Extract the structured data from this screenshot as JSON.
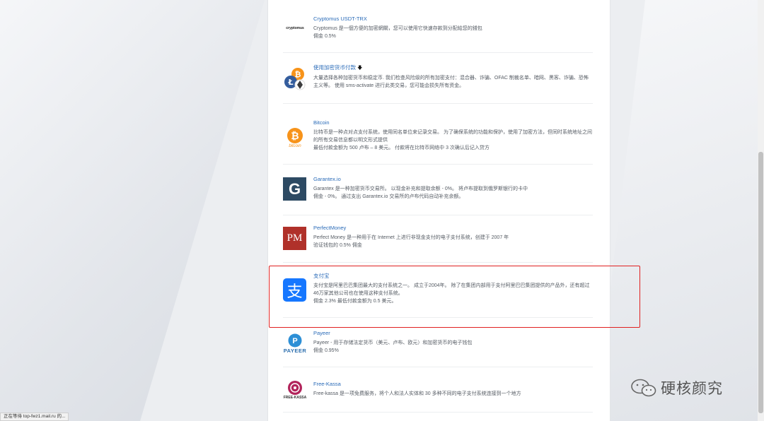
{
  "payments": [
    {
      "title": "Cryptomus USDT-TRX",
      "logo_text": "cryptomus",
      "desc": "Cryptomus 是一個方便的加密網關，您可以使用它快速存款到分配給您的錢包",
      "meta": "佣金 0.5%"
    },
    {
      "title": "使用加密货币付款",
      "title_icon": "arrow-down-icon",
      "desc": "大量选择各种加密货币和稳定币. 我们检查风险级的所有加密支付：混合器、诈骗、OFAC 制裁名单、暗网、黑客、诈骗、恐怖主义等。 使用 sms-activate 进行此类交易，您可能会损失所有资金。",
      "meta": ""
    },
    {
      "title": "Bitcoin",
      "logo_text": "bitcoin",
      "desc": "比特币是一种点对点支付系统，使用同名单位来记录交易。 为了确保系统的功能和保护，使用了加密方法，但同时系统地址之间的所有交易信息都以明文形式提供",
      "meta": "最低付款金额为 500 卢布 – 8 美元。 付款将在比特币网络中 3 次确认后记入贷方"
    },
    {
      "title": "Garantex.io",
      "logo_text": "G",
      "desc": "Garantex 是一种加密货币交易所。 以现金补充和提取余额 - 0%。 将卢布提取到俄罗斯银行的卡中",
      "meta": "佣金 - 0%。 通过支出 Garantex.io 交易所的卢布代码自动补充余额。"
    },
    {
      "title": "PerfectMoney",
      "logo_text": "PM",
      "desc": "Perfect Money 是一种用于在 Internet 上进行非现金支付的电子支付系统，创建于 2007 年",
      "meta": "验证钱包的 0.5% 佣金"
    },
    {
      "title": "支付宝",
      "logo_text": "支",
      "desc": "支付宝是阿里巴巴集团最大的支付系统之一。 成立于2004年。 除了在集团内部用于支付阿里巴巴集团提供的产品外，还有超过46万家其他公司也在使用这种支付系统。",
      "meta": "佣金 2.3% 最低付款金额为 0.5 美元。"
    },
    {
      "title": "Payeer",
      "logo_text": "PAYEER",
      "logo_letter": "P",
      "desc": "Payeer - 用于存储法定货币（美元、卢布、欧元）和加密货币的电子钱包",
      "meta": "佣金 0.95%"
    },
    {
      "title": "Free-Kassa",
      "logo_text": "FREE-KASSA",
      "desc": "Free-kassa 是一项免费服务，将个人和法人实体和 30 多种不同的电子支付系统连接到一个地方",
      "meta": ""
    }
  ],
  "status_text": "正在等待 top-fwz1.mail.ru 的...",
  "watermark_text": "硬核颜究",
  "colors": {
    "link": "#2a6bb8",
    "highlight": "#e02020",
    "alipay": "#1677ff",
    "bitcoin": "#f7931a",
    "garantex": "#2d4a63",
    "pm": "#b0312a",
    "payeer": "#2d8fd6"
  }
}
